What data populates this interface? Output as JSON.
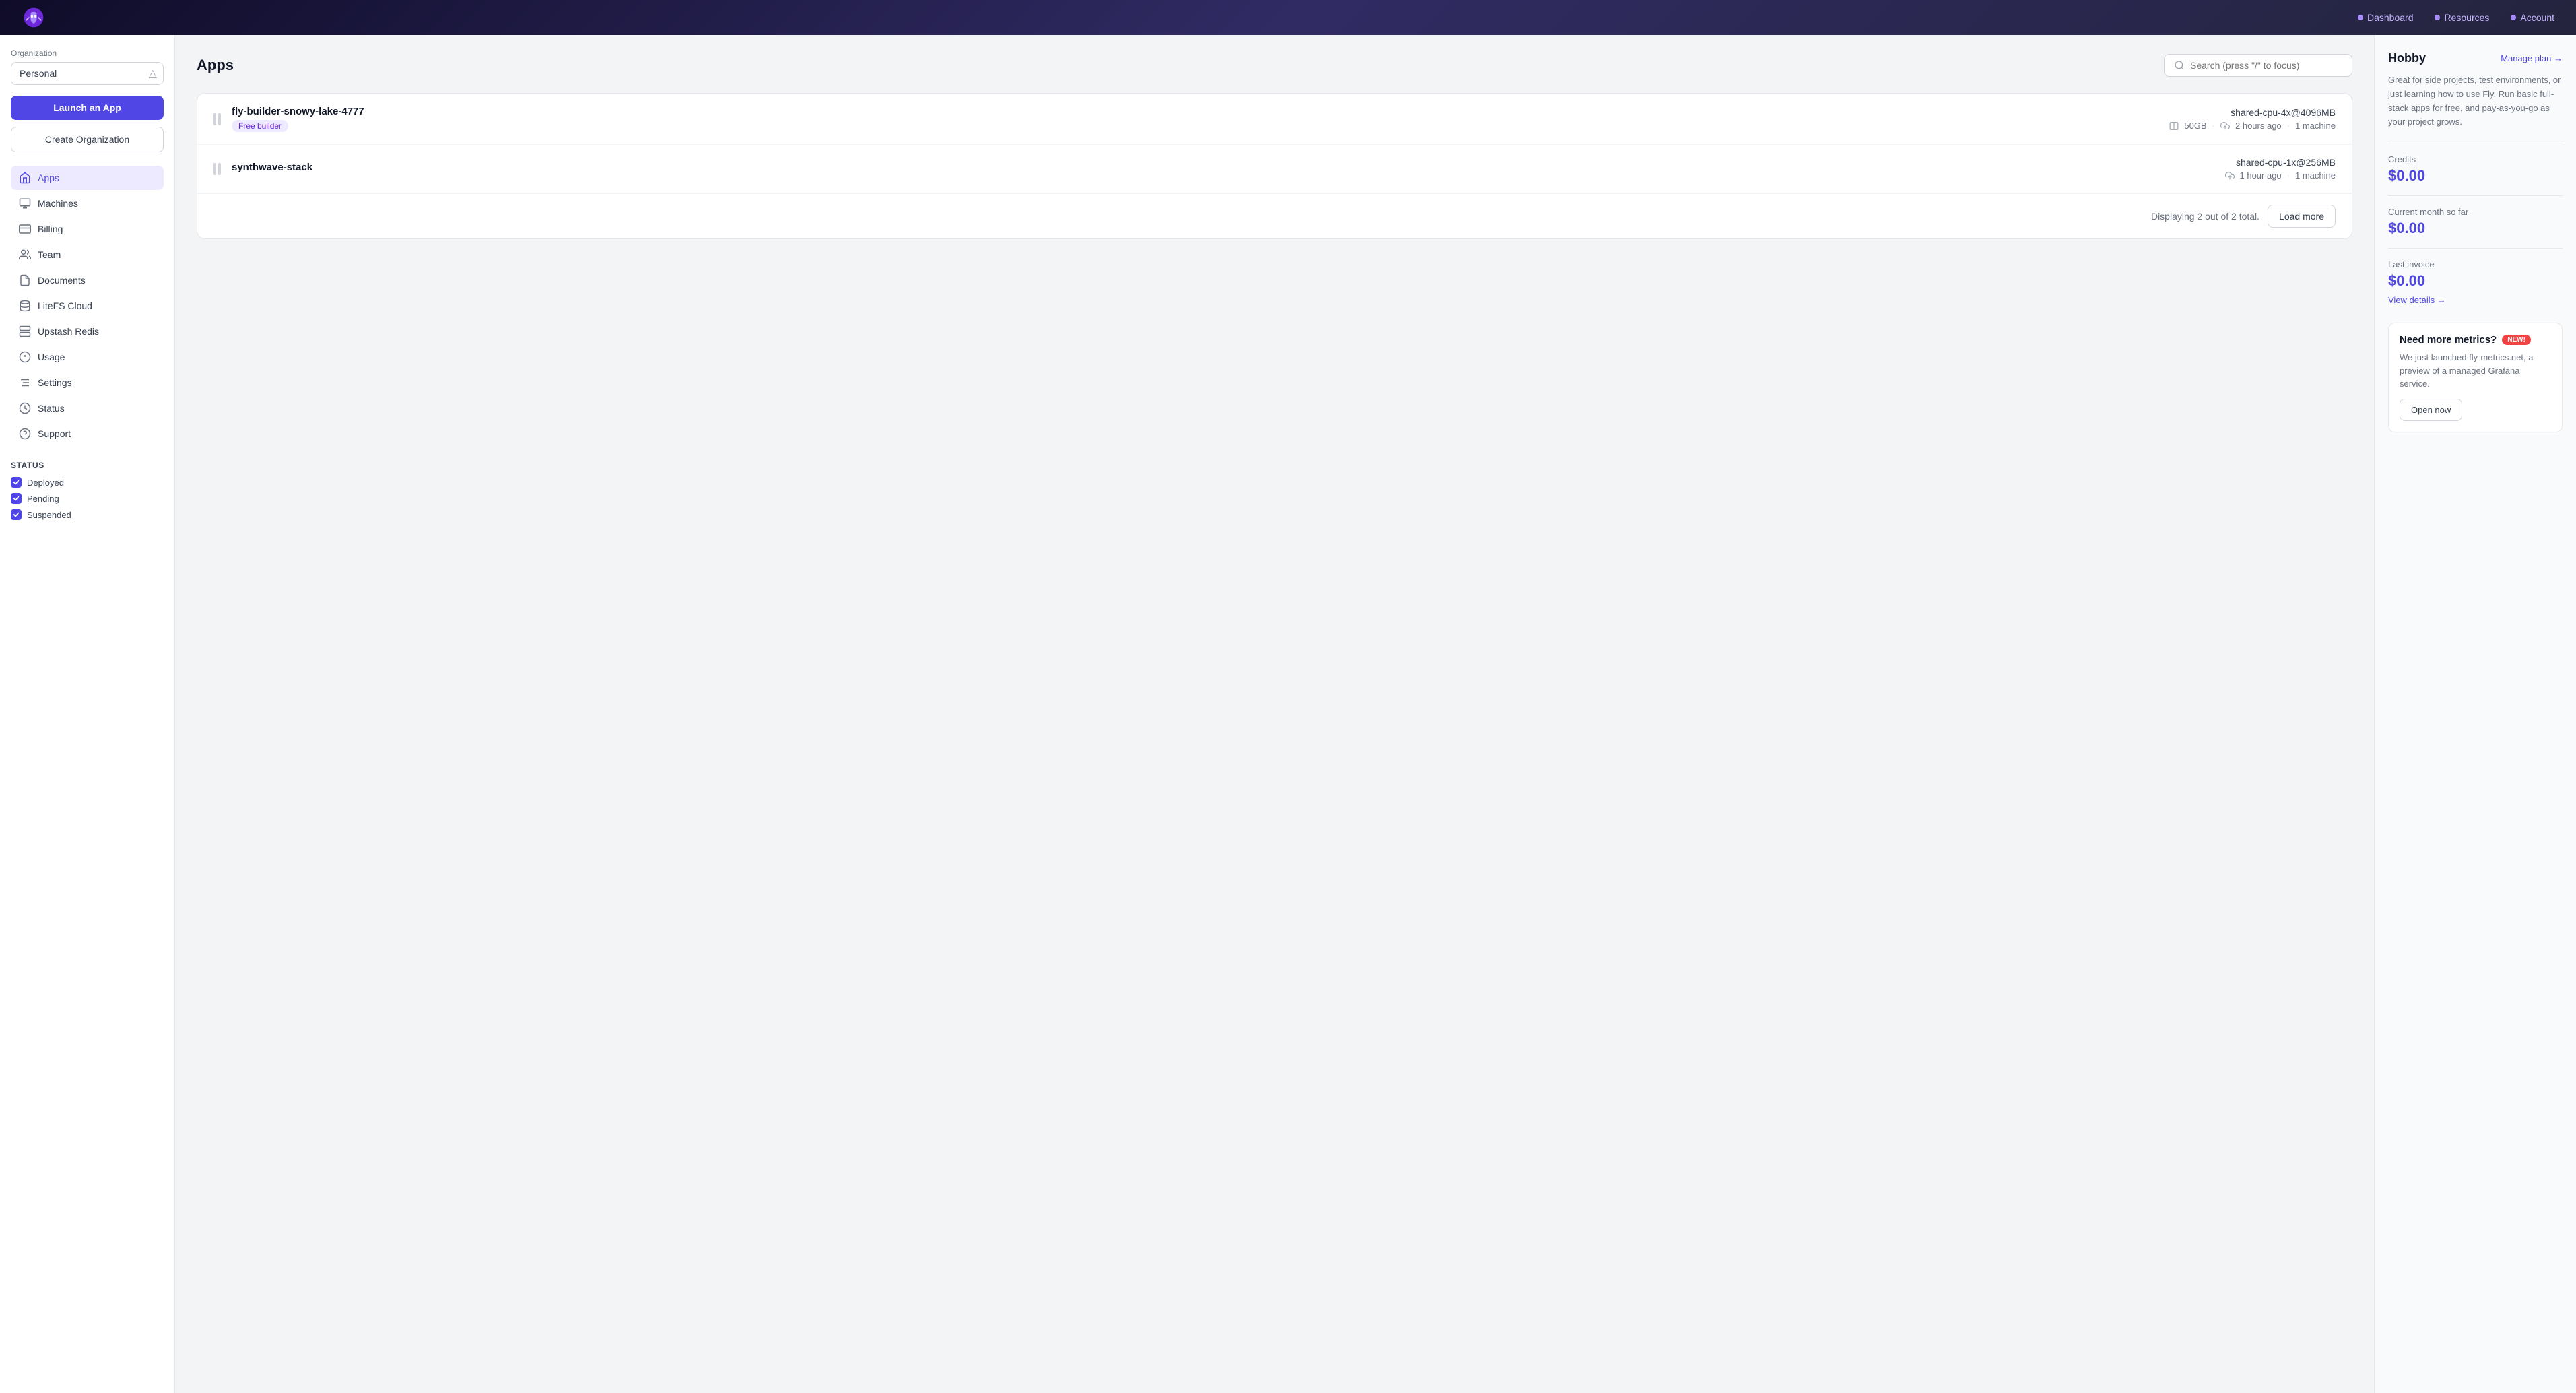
{
  "topnav": {
    "links": [
      {
        "id": "dashboard",
        "label": "Dashboard",
        "dot_color": "#a78bfa"
      },
      {
        "id": "resources",
        "label": "Resources",
        "dot_color": "#a78bfa"
      },
      {
        "id": "account",
        "label": "Account",
        "dot_color": "#a78bfa"
      }
    ]
  },
  "sidebar": {
    "org_label": "Organization",
    "org_value": "Personal",
    "launch_button": "Launch an App",
    "create_org_button": "Create Organization",
    "nav_items": [
      {
        "id": "apps",
        "label": "Apps",
        "active": true
      },
      {
        "id": "machines",
        "label": "Machines",
        "active": false
      },
      {
        "id": "billing",
        "label": "Billing",
        "active": false
      },
      {
        "id": "team",
        "label": "Team",
        "active": false
      },
      {
        "id": "documents",
        "label": "Documents",
        "active": false
      },
      {
        "id": "litefs",
        "label": "LiteFS Cloud",
        "active": false
      },
      {
        "id": "upstash",
        "label": "Upstash Redis",
        "active": false
      },
      {
        "id": "usage",
        "label": "Usage",
        "active": false
      },
      {
        "id": "settings",
        "label": "Settings",
        "active": false
      },
      {
        "id": "status",
        "label": "Status",
        "active": false
      },
      {
        "id": "support",
        "label": "Support",
        "active": false
      }
    ],
    "status": {
      "title": "Status",
      "items": [
        {
          "id": "deployed",
          "label": "Deployed",
          "checked": true
        },
        {
          "id": "pending",
          "label": "Pending",
          "checked": true
        },
        {
          "id": "suspended",
          "label": "Suspended",
          "checked": true
        }
      ]
    }
  },
  "main": {
    "title": "Apps",
    "search_placeholder": "Search (press \"/\" to focus)",
    "apps": [
      {
        "id": "fly-builder-snowy-lake-4777",
        "name": "fly-builder-snowy-lake-4777",
        "badge": "Free builder",
        "spec": "shared-cpu-4x@4096MB",
        "storage": "50GB",
        "updated": "2 hours ago",
        "machines": "1 machine"
      },
      {
        "id": "synthwave-stack",
        "name": "synthwave-stack",
        "badge": null,
        "spec": "shared-cpu-1x@256MB",
        "storage": null,
        "updated": "1 hour ago",
        "machines": "1 machine"
      }
    ],
    "display_count": "Displaying 2 out of 2 total.",
    "load_more_button": "Load more"
  },
  "right_panel": {
    "plan_name": "Hobby",
    "manage_plan_link": "Manage plan →",
    "plan_desc": "Great for side projects, test environments, or just learning how to use Fly. Run basic full-stack apps for free, and pay-as-you-go as your project grows.",
    "credits_label": "Credits",
    "credits_value": "$0.00",
    "current_month_label": "Current month so far",
    "current_month_value": "$0.00",
    "last_invoice_label": "Last invoice",
    "last_invoice_value": "$0.00",
    "view_details_link": "View details →",
    "metrics_title": "Need more metrics?",
    "metrics_badge": "new!",
    "metrics_desc": "We just launched fly-metrics.net, a preview of a managed Grafana service.",
    "open_now_button": "Open now"
  }
}
